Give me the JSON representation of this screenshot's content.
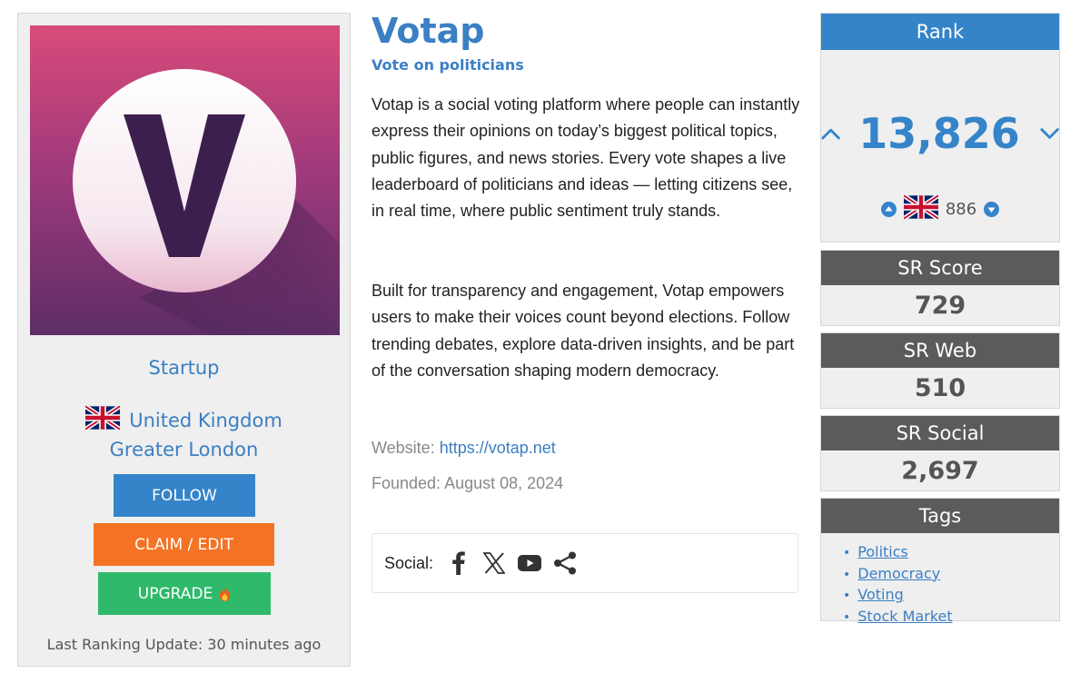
{
  "startup": {
    "name": "Votap",
    "tagline": "Vote on politicians",
    "description_1": "Votap is a social voting platform where people can instantly express their opinions on today’s biggest political topics, public figures, and news stories. Every vote shapes a live leaderboard of politicians and ideas — letting citizens see, in real time, where public sentiment truly stands.",
    "description_2": "Built for transparency and engagement, Votap empowers users to make their voices count beyond elections. Follow trending debates, explore data-driven insights, and be part of the conversation shaping modern democracy.",
    "website_label": "Website:",
    "website_url": "https://votap.net",
    "founded": "Founded: August 08, 2024",
    "social_label": "Social:",
    "social_icons": [
      "facebook-icon",
      "x-twitter-icon",
      "youtube-icon",
      "share-icon"
    ]
  },
  "left": {
    "category": "Startup",
    "country": "United Kingdom",
    "region": "Greater London",
    "follow_label": "FOLLOW",
    "claim_label": "CLAIM / EDIT",
    "upgrade_label": "UPGRADE",
    "last_update": "Last Ranking Update: 30 minutes ago"
  },
  "rank": {
    "title": "Rank",
    "value": "13,826",
    "country_rank": "886"
  },
  "scores": {
    "sr_score_label": "SR Score",
    "sr_score": "729",
    "sr_web_label": "SR Web",
    "sr_web": "510",
    "sr_social_label": "SR Social",
    "sr_social": "2,697"
  },
  "tags": {
    "title": "Tags",
    "items": [
      "Politics",
      "Democracy",
      "Voting",
      "Stock Market"
    ]
  },
  "colors": {
    "accent": "#3584c9",
    "follow": "#3584c9",
    "claim": "#f47324",
    "upgrade": "#2fba6b",
    "box_header": "#5b5b5b"
  }
}
